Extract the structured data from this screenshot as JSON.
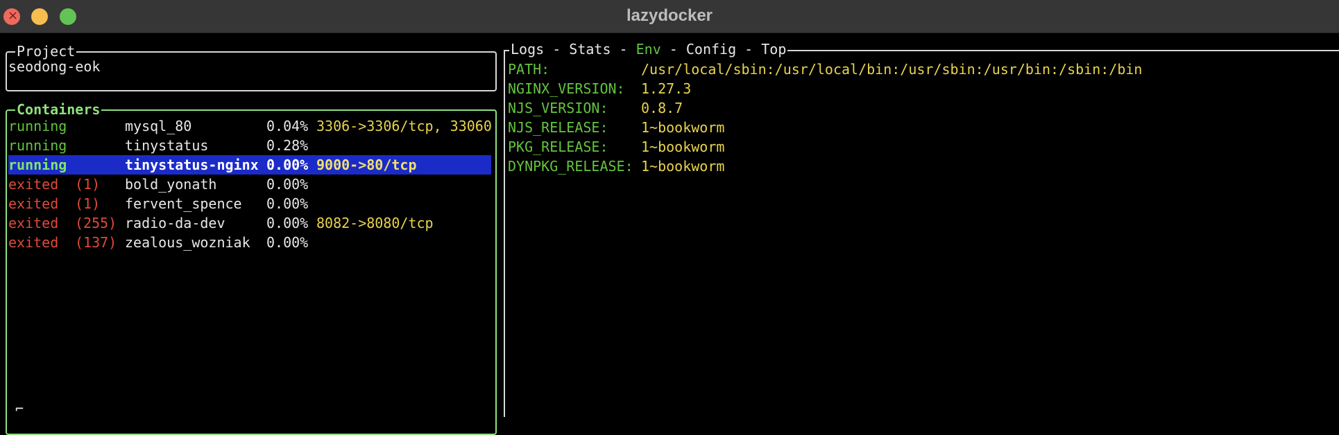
{
  "window": {
    "title": "lazydocker"
  },
  "project": {
    "panel_title": "Project",
    "name": "seodong-eok"
  },
  "containers": {
    "panel_title": "Containers",
    "rows": [
      {
        "status": "running",
        "code": "",
        "name": "mysql_80",
        "cpu": "0.04%",
        "ports": "3306->3306/tcp, 33060",
        "selected": false
      },
      {
        "status": "running",
        "code": "",
        "name": "tinystatus",
        "cpu": "0.28%",
        "ports": "",
        "selected": false
      },
      {
        "status": "running",
        "code": "",
        "name": "tinystatus-nginx",
        "cpu": "0.00%",
        "ports": "9000->80/tcp",
        "selected": true
      },
      {
        "status": "exited",
        "code": "(1)",
        "name": "bold_yonath",
        "cpu": "0.00%",
        "ports": "",
        "selected": false
      },
      {
        "status": "exited",
        "code": "(1)",
        "name": "fervent_spence",
        "cpu": "0.00%",
        "ports": "",
        "selected": false
      },
      {
        "status": "exited",
        "code": "(255)",
        "name": "radio-da-dev",
        "cpu": "0.00%",
        "ports": "8082->8080/tcp",
        "selected": false
      },
      {
        "status": "exited",
        "code": "(137)",
        "name": "zealous_wozniak",
        "cpu": "0.00%",
        "ports": "",
        "selected": false
      }
    ]
  },
  "details": {
    "tabs": [
      "Logs",
      "Stats",
      "Env",
      "Config",
      "Top"
    ],
    "separator": " - ",
    "active_tab": "Env",
    "env": [
      {
        "key": "PATH:",
        "value": "/usr/local/sbin:/usr/local/bin:/usr/sbin:/usr/bin:/sbin:/bin"
      },
      {
        "key": "NGINX_VERSION:",
        "value": "1.27.3"
      },
      {
        "key": "NJS_VERSION:",
        "value": "0.8.7"
      },
      {
        "key": "NJS_RELEASE:",
        "value": "1~bookworm"
      },
      {
        "key": "PKG_RELEASE:",
        "value": "1~bookworm"
      },
      {
        "key": "DYNPKG_RELEASE:",
        "value": "1~bookworm"
      }
    ]
  },
  "colors": {
    "running": "#63c43e",
    "exited": "#e04a3a",
    "selection": "#1b2bc8",
    "accent_border": "#8fe07e",
    "ports": "#e8d44d"
  }
}
